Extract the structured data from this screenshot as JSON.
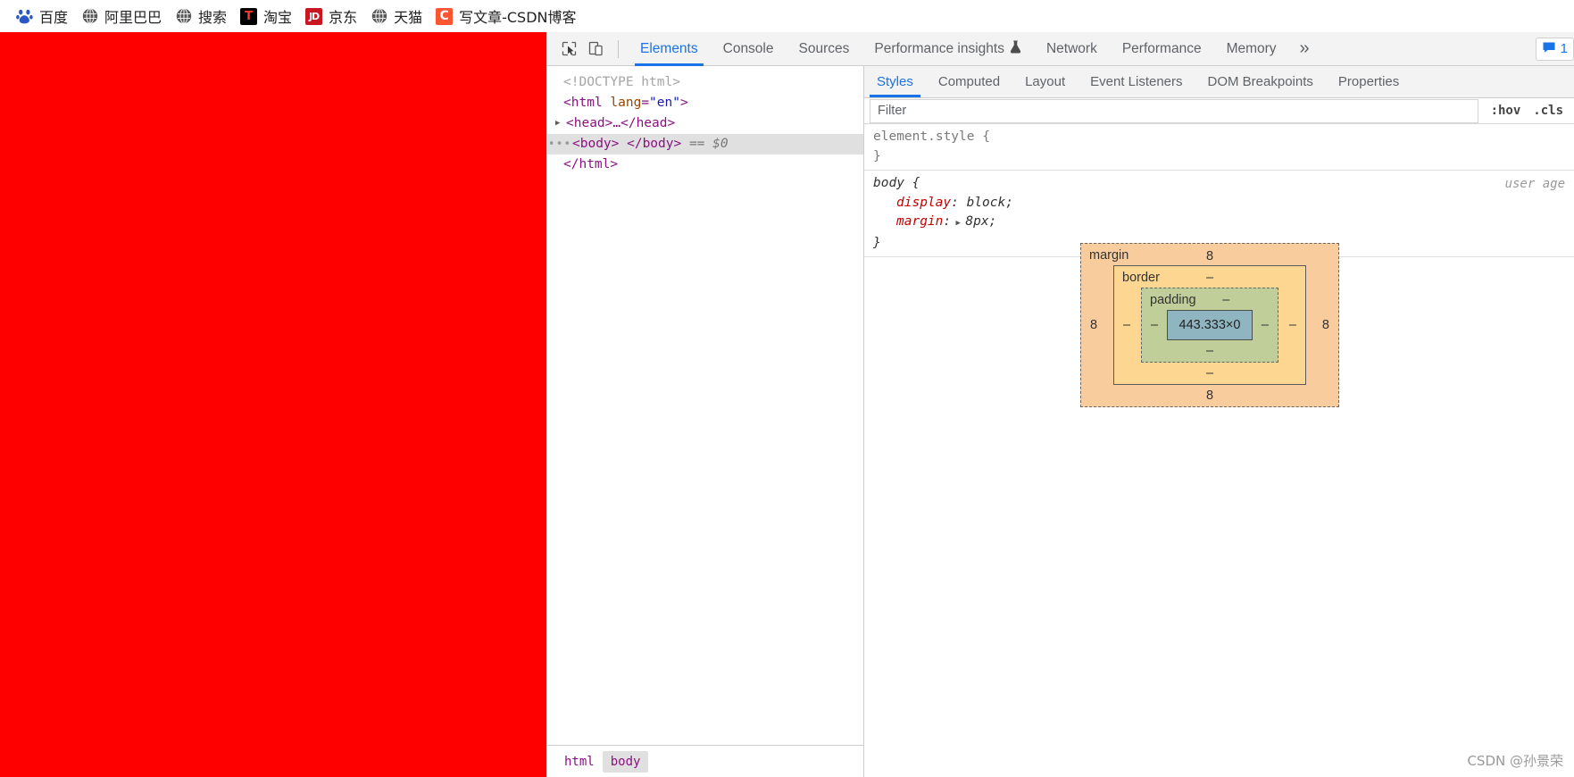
{
  "bookmarks": [
    {
      "label": "百度",
      "icon": "baidu-paw-icon",
      "icon_kind": "baidu"
    },
    {
      "label": "阿里巴巴",
      "icon": "globe-icon",
      "icon_kind": "globe"
    },
    {
      "label": "搜索",
      "icon": "globe-icon",
      "icon_kind": "globe"
    },
    {
      "label": "淘宝",
      "icon": "taobao-icon",
      "icon_kind": "taobao",
      "glyph": "T"
    },
    {
      "label": "京东",
      "icon": "jd-icon",
      "icon_kind": "jd",
      "glyph": "JD"
    },
    {
      "label": "天猫",
      "icon": "globe-icon",
      "icon_kind": "globe"
    },
    {
      "label": "写文章-CSDN博客",
      "icon": "csdn-icon",
      "icon_kind": "csdn",
      "glyph": "C"
    }
  ],
  "devtools": {
    "toolbar": {
      "inspect_icon": "inspect-cursor-icon",
      "device_icon": "device-toolbar-icon",
      "tabs": [
        {
          "label": "Elements",
          "active": true
        },
        {
          "label": "Console",
          "active": false
        },
        {
          "label": "Sources",
          "active": false
        },
        {
          "label": "Performance insights",
          "active": false,
          "badge_icon": "experiment-flask-icon"
        },
        {
          "label": "Network",
          "active": false
        },
        {
          "label": "Performance",
          "active": false
        },
        {
          "label": "Memory",
          "active": false
        }
      ],
      "overflow_label": "»",
      "issues": {
        "icon": "issues-message-icon",
        "count": "1"
      }
    },
    "dom_tree": {
      "lines": [
        {
          "kind": "doctype",
          "text": "<!DOCTYPE html>"
        },
        {
          "kind": "open",
          "tag": "html",
          "attr": "lang",
          "value": "\"en\""
        },
        {
          "kind": "collapsed",
          "text": "<head>…</head>"
        },
        {
          "kind": "selected",
          "text": "<body> </body>",
          "suffix": "== $0"
        },
        {
          "kind": "close",
          "text": "</html>"
        }
      ]
    },
    "breadcrumb": [
      {
        "label": "html",
        "active": false
      },
      {
        "label": "body",
        "active": true
      }
    ],
    "styles": {
      "tabs": [
        {
          "label": "Styles",
          "active": true
        },
        {
          "label": "Computed",
          "active": false
        },
        {
          "label": "Layout",
          "active": false
        },
        {
          "label": "Event Listeners",
          "active": false
        },
        {
          "label": "DOM Breakpoints",
          "active": false
        },
        {
          "label": "Properties",
          "active": false
        }
      ],
      "filter_placeholder": "Filter",
      "filter_value": "",
      "toggles": [
        ":hov",
        ".cls"
      ],
      "rules": [
        {
          "selector": "element.style {",
          "close": "}",
          "origin": "",
          "declarations": []
        },
        {
          "selector": "body {",
          "close": "}",
          "origin": "user age",
          "declarations": [
            {
              "property": "display",
              "value": "block;",
              "expandable": false
            },
            {
              "property": "margin",
              "value": "8px;",
              "expandable": true
            }
          ]
        }
      ],
      "box_model": {
        "margin_label": "margin",
        "border_label": "border",
        "padding_label": "padding",
        "content_label": "443.333×0",
        "margin_top": "8",
        "margin_right": "8",
        "margin_bottom": "8",
        "margin_left": "8",
        "border_top": "–",
        "border_right": "–",
        "border_bottom": "–",
        "border_left": "–",
        "padding_top": "–",
        "padding_right": "–",
        "padding_bottom": "–",
        "padding_left": "–"
      }
    }
  },
  "watermark": "CSDN @孙景荣",
  "colors": {
    "page_background": "#ff0000",
    "accent": "#1a73e8",
    "box_margin": "#f9cc9d",
    "box_border": "#fdd791",
    "box_padding": "#c0ce9a",
    "box_content": "#8fb5c1"
  }
}
